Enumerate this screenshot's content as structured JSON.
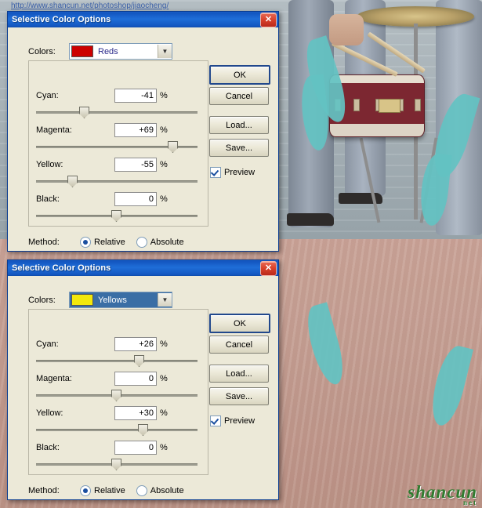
{
  "background": {
    "watermark": {
      "text": "shancun",
      "sub": "net"
    },
    "url_overlay": "http://www.shancun.net/photoshop/jiaocheng/"
  },
  "dialogs": [
    {
      "title": "Selective Color Options",
      "close_label": "✕",
      "colors_label": "Colors:",
      "colors_value": "Reds",
      "colors_swatch": "#cc0000",
      "dropdown_arrow": "▼",
      "channels": [
        {
          "label": "Cyan:",
          "value": "-41",
          "unit": "%",
          "slider_pct": 29.5
        },
        {
          "label": "Magenta:",
          "value": "+69",
          "unit": "%",
          "slider_pct": 84.5
        },
        {
          "label": "Yellow:",
          "value": "-55",
          "unit": "%",
          "slider_pct": 22.5
        },
        {
          "label": "Black:",
          "value": "0",
          "unit": "%",
          "slider_pct": 50.0
        }
      ],
      "buttons": [
        {
          "label": "OK",
          "default": true
        },
        {
          "label": "Cancel",
          "default": false
        },
        {
          "label": "Load...",
          "default": false
        },
        {
          "label": "Save...",
          "default": false
        }
      ],
      "preview": {
        "label": "Preview",
        "checked": true
      },
      "method": {
        "label": "Method:",
        "options": [
          {
            "label": "Relative",
            "selected": true
          },
          {
            "label": "Absolute",
            "selected": false
          }
        ]
      }
    },
    {
      "title": "Selective Color Options",
      "close_label": "✕",
      "colors_label": "Colors:",
      "colors_value": "Yellows",
      "colors_swatch": "#f2e80c",
      "dropdown_arrow": "▼",
      "channels": [
        {
          "label": "Cyan:",
          "value": "+26",
          "unit": "%",
          "slider_pct": 63.0
        },
        {
          "label": "Magenta:",
          "value": "0",
          "unit": "%",
          "slider_pct": 50.0
        },
        {
          "label": "Yellow:",
          "value": "+30",
          "unit": "%",
          "slider_pct": 65.0
        },
        {
          "label": "Black:",
          "value": "0",
          "unit": "%",
          "slider_pct": 50.0
        }
      ],
      "buttons": [
        {
          "label": "OK",
          "default": true
        },
        {
          "label": "Cancel",
          "default": false
        },
        {
          "label": "Load...",
          "default": false
        },
        {
          "label": "Save...",
          "default": false
        }
      ],
      "preview": {
        "label": "Preview",
        "checked": true
      },
      "method": {
        "label": "Method:",
        "options": [
          {
            "label": "Relative",
            "selected": true
          },
          {
            "label": "Absolute",
            "selected": false
          }
        ]
      }
    }
  ]
}
